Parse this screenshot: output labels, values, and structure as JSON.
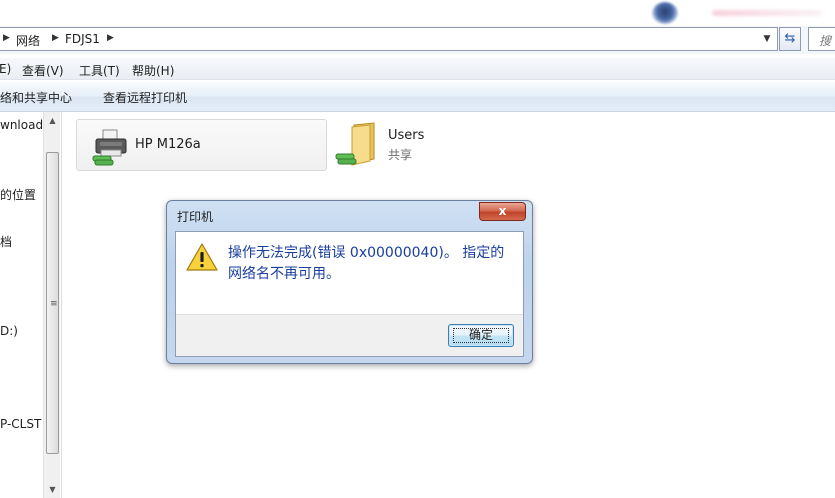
{
  "address_bar": {
    "crumbs": [
      "网络",
      "FDJS1"
    ],
    "search_placeholder": "搜"
  },
  "menu": [
    "E)",
    "查看(V)",
    "工具(T)",
    "帮助(H)"
  ],
  "command_bar": [
    "络和共享中心",
    "查看远程打印机"
  ],
  "nav_pane": {
    "items": [
      "wnloads",
      "的位置",
      "档",
      "D:)",
      "P-CLST"
    ]
  },
  "items": [
    {
      "name": "HP M126a",
      "subtitle": "",
      "icon": "shared-printer-icon"
    },
    {
      "name": "Users",
      "subtitle": "共享",
      "icon": "shared-folder-icon"
    }
  ],
  "dialog": {
    "title": "打印机",
    "close_glyph": "x",
    "message": "操作无法完成(错误 0x00000040)。 指定的网络名不再可用。",
    "ok_label": "确定",
    "icon": "warning-icon"
  },
  "colors": {
    "dialog_text": "#1a3ea0",
    "close_button": "#c0432a"
  }
}
